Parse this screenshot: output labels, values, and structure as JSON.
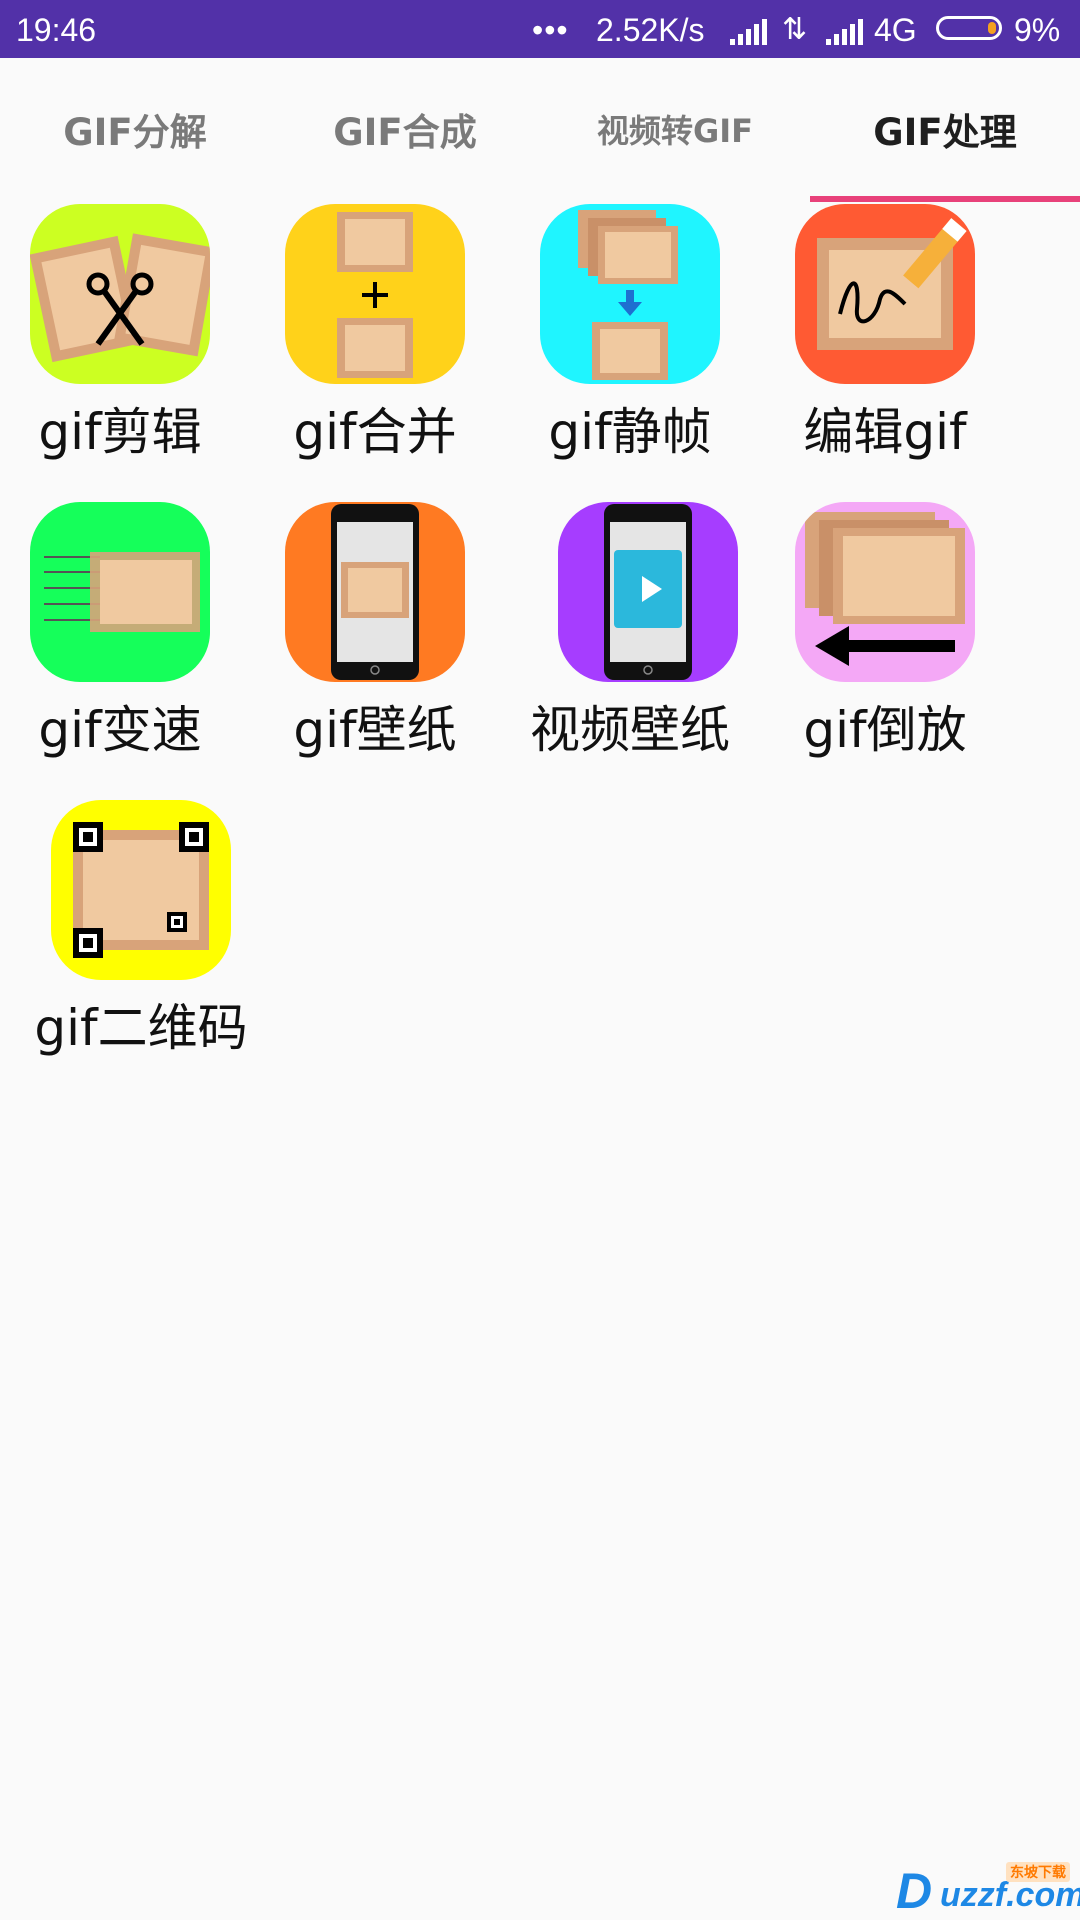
{
  "status_bar": {
    "time": "19:46",
    "dots": "•••",
    "speed": "2.52K/s",
    "network": "4G",
    "battery": "9%",
    "data_arrows": "⇅"
  },
  "tabs": [
    {
      "label": "GIF分解",
      "active": false
    },
    {
      "label": "GIF合成",
      "active": false
    },
    {
      "label": "视频转GIF",
      "active": false
    },
    {
      "label": "GIF处理",
      "active": true
    }
  ],
  "tools": [
    {
      "label": "gif剪辑",
      "icon": "scissors-icon",
      "bg": "#ccff22"
    },
    {
      "label": "gif合并",
      "icon": "merge-icon",
      "bg": "#ffd21a"
    },
    {
      "label": "gif静帧",
      "icon": "still-frame-icon",
      "bg": "#1ff5ff"
    },
    {
      "label": "编辑gif",
      "icon": "edit-pen-icon",
      "bg": "#ff5a33"
    },
    {
      "label": "gif变速",
      "icon": "speed-icon",
      "bg": "#15ff5a"
    },
    {
      "label": "gif壁纸",
      "icon": "phone-wallpaper-icon",
      "bg": "#ff7a22"
    },
    {
      "label": "视频壁纸",
      "icon": "video-wallpaper-icon",
      "bg": "#a63dff"
    },
    {
      "label": "gif倒放",
      "icon": "reverse-icon",
      "bg": "#f4a8f6"
    },
    {
      "label": "gif二维码",
      "icon": "qr-code-icon",
      "bg": "#ffff00"
    }
  ],
  "watermark": {
    "text": "uzzf.com",
    "sub": "东坡下载"
  },
  "colors": {
    "status_bar": "#5231a8",
    "tab_indicator": "#e8417a",
    "photo_frame": "#d8a37a",
    "photo_inner": "#f0c9a0"
  }
}
